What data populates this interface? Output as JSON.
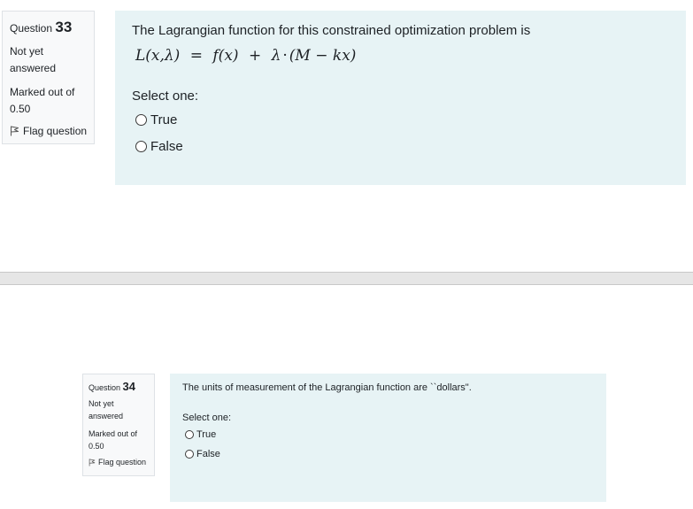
{
  "questions": [
    {
      "label": "Question",
      "number": "33",
      "status": [
        "Not yet",
        "answered"
      ],
      "marks": [
        "Marked out of",
        "0.50"
      ],
      "flag_label": "Flag question",
      "text": "The Lagrangian function for this constrained optimization problem is",
      "formula": {
        "lhs": "L(x,λ)",
        "eq": "=",
        "f": "f(x)",
        "plus": "+",
        "lambda": "λ",
        "dot": "·",
        "paren": "(M − kx)"
      },
      "prompt": "Select one:",
      "options": [
        "True",
        "False"
      ]
    },
    {
      "label": "Question",
      "number": "34",
      "status": [
        "Not yet",
        "answered"
      ],
      "marks": [
        "Marked out of",
        "0.50"
      ],
      "flag_label": "Flag question",
      "text": "The units of measurement of the Lagrangian function are ``dollars\".",
      "prompt": "Select one:",
      "options": [
        "True",
        "False"
      ]
    }
  ],
  "icons": {
    "flag": "flag-icon",
    "radio": "radio-button"
  },
  "colors": {
    "content_bg": "#e7f3f5",
    "info_bg": "#f8f9fa",
    "border": "#dee2e6",
    "divider": "#e6e6e6"
  }
}
